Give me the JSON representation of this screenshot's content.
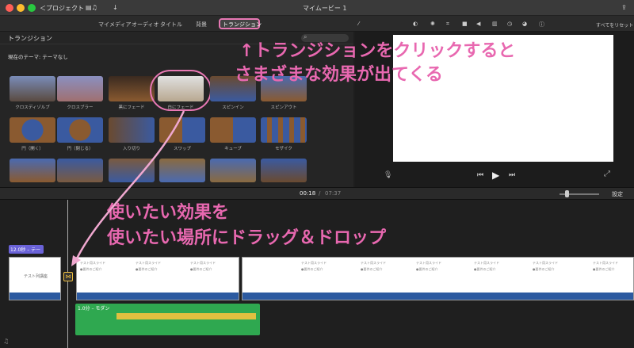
{
  "titlebar": {
    "back_label": "＜プロジェクト",
    "title": "マイムービー 1"
  },
  "tabs": [
    {
      "label": "マイメディア"
    },
    {
      "label": "オーディオ"
    },
    {
      "label": "タイトル"
    },
    {
      "label": "背景"
    },
    {
      "label": "トランジション"
    }
  ],
  "reset_label": "すべてをリセット",
  "library": {
    "header": "トランジション",
    "theme": "現在のテーマ: テーマなし",
    "search_placeholder": "検索"
  },
  "transitions": [
    {
      "label": "クロスディゾルブ"
    },
    {
      "label": "クロスブラー"
    },
    {
      "label": "黒にフェード"
    },
    {
      "label": "白にフェード"
    },
    {
      "label": "スピンイン"
    },
    {
      "label": "スピンアウト"
    },
    {
      "label": "円（開く）"
    },
    {
      "label": "円（閉じる）"
    },
    {
      "label": "入り切り"
    },
    {
      "label": "スワップ"
    },
    {
      "label": "キューブ"
    },
    {
      "label": "モザイク"
    }
  ],
  "annotations": {
    "top_line1": "↑トランジションをクリックすると",
    "top_line2": "さまざまな効果が出てくる",
    "bottom_line1": "使いたい効果を",
    "bottom_line2": "使いたい場所にドラッグ＆ドロップ"
  },
  "timecode": {
    "current": "00:18",
    "separator": "/",
    "total": "07:37"
  },
  "settings_label": "設定",
  "timeline": {
    "title_clip_label": "12.0秒 – テー",
    "first_clip_text": "テスト列講座",
    "audio_clip_label": "1.0分 – モダン",
    "slide_title": "テスト用スライド",
    "slide_sub": "●要件のご紹介"
  },
  "colors": {
    "accent": "#e868b0",
    "audio": "#2fa850",
    "title_clip": "#6a62d8"
  }
}
